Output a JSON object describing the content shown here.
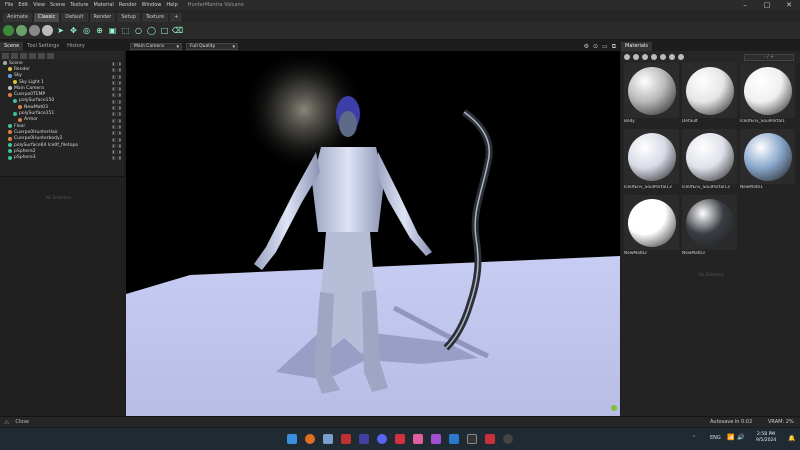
{
  "title_bar": {
    "menu": [
      "File",
      "Edit",
      "View",
      "Scene",
      "Texture",
      "Material",
      "Render",
      "Window",
      "Help"
    ],
    "title": "HunterMantra Volcano",
    "window_controls": [
      "–",
      "□",
      "✕"
    ]
  },
  "layout_tabs": [
    {
      "label": "Animate",
      "active": false
    },
    {
      "label": "Classic",
      "active": true
    },
    {
      "label": "Default",
      "active": false
    },
    {
      "label": "Render",
      "active": false
    },
    {
      "label": "Setup",
      "active": false
    },
    {
      "label": "Texture",
      "active": false
    },
    {
      "label": "+",
      "active": false
    }
  ],
  "left_panel": {
    "tabs": [
      {
        "label": "Scene",
        "active": true
      },
      {
        "label": "Tool Settings",
        "active": false
      },
      {
        "label": "History",
        "active": false
      }
    ],
    "tree": [
      {
        "label": "Scene",
        "depth": 0,
        "color": "#aaaaaa"
      },
      {
        "label": "Render",
        "depth": 1,
        "color": "#e0c040"
      },
      {
        "label": "Sky",
        "depth": 1,
        "color": "#60a0e0"
      },
      {
        "label": "Sky Light 1",
        "depth": 2,
        "color": "#e0c040"
      },
      {
        "label": "Main Camera",
        "depth": 1,
        "color": "#c0c0c0"
      },
      {
        "label": "Cuerpo0TEMP",
        "depth": 1,
        "color": "#e08040"
      },
      {
        "label": "polySurface150",
        "depth": 2,
        "color": "#40c0a0"
      },
      {
        "label": "NewMat03",
        "depth": 3,
        "color": "#e08040"
      },
      {
        "label": "polySurface151",
        "depth": 2,
        "color": "#40c0a0"
      },
      {
        "label": "Armor",
        "depth": 3,
        "color": "#e08040"
      },
      {
        "label": "Floor",
        "depth": 1,
        "color": "#40c0a0"
      },
      {
        "label": "Cuerpo0HunterHair",
        "depth": 1,
        "color": "#e08040"
      },
      {
        "label": "Cuerpo0Hunterbody2",
        "depth": 1,
        "color": "#e08040"
      },
      {
        "label": "polySurface64 Ice0f_filetopo",
        "depth": 1,
        "color": "#40c0a0"
      },
      {
        "label": "pSphere2",
        "depth": 1,
        "color": "#40c0a0"
      },
      {
        "label": "pSphere3",
        "depth": 1,
        "color": "#40c0a0"
      }
    ],
    "lower_hint": "No Selection"
  },
  "viewport": {
    "camera": "Main Camera",
    "quality": "Full Quality"
  },
  "materials_panel": {
    "tab": "Materials",
    "search_placeholder": "- / +",
    "items": [
      {
        "label": "Body",
        "color": "#b8b8b8"
      },
      {
        "label": "Default",
        "color": "#e6e6e6"
      },
      {
        "label": "Ice0fEnv_SoulPortal1",
        "color": "#f0f0f0"
      },
      {
        "label": "Ice0fEnv_SoulPortal13",
        "color": "#d8dbe6"
      },
      {
        "label": "Ice0fEnv_SoulPortal13",
        "color": "#dfe2ea"
      },
      {
        "label": "NewMat01",
        "color": "#8aa8cc"
      },
      {
        "label": "NewMat02",
        "color": "#ffffff"
      },
      {
        "label": "NewMat03",
        "color": "#3a3e44"
      }
    ],
    "lower_hint": "No Selection"
  },
  "status_bar": {
    "left": "Close",
    "autosave": "Autosave in 0:02",
    "vram": "VRAM: 2%"
  },
  "taskbar": {
    "lang": "ENG",
    "time": "2:58 PM",
    "date": "9/5/2024"
  }
}
